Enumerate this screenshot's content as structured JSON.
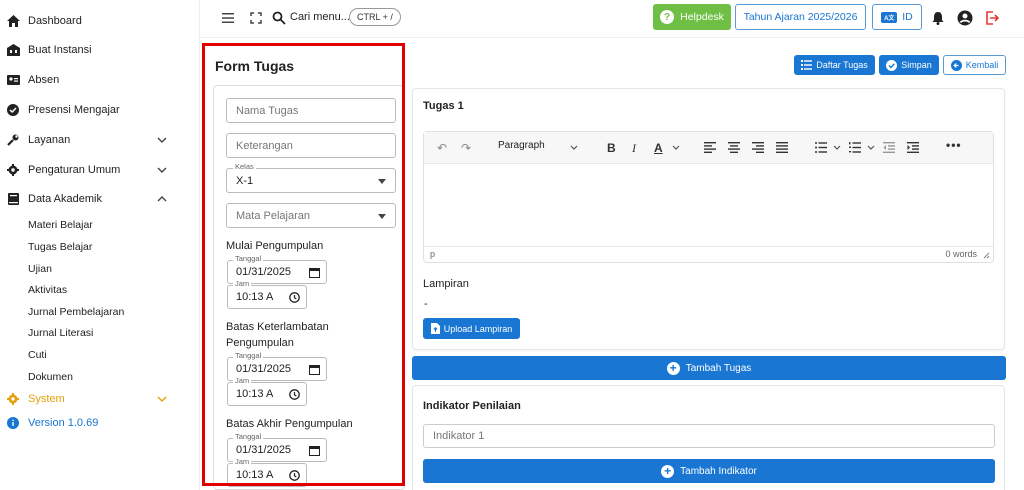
{
  "sidebar": {
    "items": [
      {
        "label": "Dashboard",
        "icon": "home-icon"
      },
      {
        "label": "Buat Instansi",
        "icon": "building-icon"
      },
      {
        "label": "Absen",
        "icon": "id-card-icon"
      },
      {
        "label": "Presensi Mengajar",
        "icon": "check-circle-icon"
      },
      {
        "label": "Layanan",
        "icon": "wrench-icon"
      },
      {
        "label": "Pengaturan Umum",
        "icon": "gear-icon"
      },
      {
        "label": "Data Akademik",
        "icon": "book-icon"
      }
    ],
    "sub_items": [
      "Materi Belajar",
      "Tugas Belajar",
      "Ujian",
      "Aktivitas",
      "Jurnal Pembelajaran",
      "Jurnal Literasi",
      "Cuti",
      "Dokumen"
    ],
    "system": {
      "label": "System",
      "icon": "gear-icon",
      "color": "#e3a008"
    },
    "version": {
      "label": "Version 1.0.69",
      "icon": "info-icon",
      "color": "#1976d2"
    }
  },
  "topbar": {
    "search_label": "Cari menu...",
    "shortcut": "CTRL + /",
    "helpdesk": "Helpdesk",
    "school_year": "Tahun Ajaran 2025/2026",
    "language": "ID",
    "language_flag": "A文"
  },
  "form": {
    "title": "Form Tugas",
    "nama_placeholder": "Nama Tugas",
    "keterangan_placeholder": "Keterangan",
    "kelas_label": "Kelas",
    "kelas_value": "X-1",
    "mapel_placeholder": "Mata Pelajaran",
    "tanggal_label": "Tanggal",
    "jam_label": "Jam",
    "sections": [
      {
        "label": "Mulai Pengumpulan",
        "date": "01/31/2025",
        "time": "10:13 A"
      },
      {
        "label": "Batas Keterlambatan Pengumpulan",
        "date": "01/31/2025",
        "time": "10:13 A"
      },
      {
        "label": "Batas Akhir Pengumpulan",
        "date": "01/31/2025",
        "time": "10:13 A"
      }
    ]
  },
  "actions": {
    "daftar_tugas": "Daftar Tugas",
    "simpan": "Simpan",
    "kembali": "Kembali"
  },
  "task": {
    "title": "Tugas 1",
    "editor_format": "Paragraph",
    "editor_path": "p",
    "word_count": "0 words",
    "lampiran_label": "Lampiran",
    "lampiran_value": "-",
    "upload_label": "Upload Lampiran"
  },
  "tambah_tugas": "Tambah Tugas",
  "indikator": {
    "title": "Indikator Penilaian",
    "placeholder": "Indikator 1",
    "tambah": "Tambah Indikator"
  },
  "colors": {
    "primary": "#1976d2",
    "helpdesk": "#6fbf44",
    "logout": "#e53935",
    "highlight": "#e00000"
  }
}
